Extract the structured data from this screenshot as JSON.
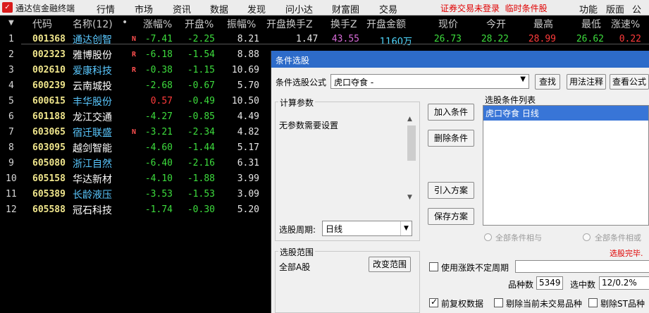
{
  "app": {
    "title": "通达信金融终端",
    "menu": [
      "行情",
      "市场",
      "资讯",
      "数据",
      "发现",
      "问小达",
      "财富圈",
      "交易"
    ],
    "status_warning": "证券交易未登录",
    "status_condition": "临时条件股",
    "right_menu": [
      "功能",
      "版面",
      "公式"
    ]
  },
  "table": {
    "headers": {
      "code": "代码",
      "name": "名称(12)",
      "dot": "•",
      "change_pct": "涨幅%",
      "open_pct": "开盘%",
      "amplitude_pct": "振幅%",
      "open_turnover": "开盘换手Z",
      "turnover": "换手Z",
      "open_amount": "开盘金额",
      "price": "现价",
      "today_open": "今开",
      "high": "最高",
      "low": "最低",
      "speed": "涨速%"
    },
    "rows": [
      {
        "idx": "1",
        "code": "001368",
        "name": "通达创智",
        "flag": "N",
        "change": "-7.41",
        "open": "-2.25",
        "amp": "8.21",
        "open_turn": "1.47",
        "turn": "43.55",
        "open_amt": "1160万",
        "price": "26.73",
        "today_open": "28.22",
        "high": "28.99",
        "low": "26.62",
        "speed": "0.22"
      },
      {
        "idx": "2",
        "code": "002323",
        "name": "雅博股份",
        "flag": "R",
        "change": "-6.18",
        "open": "-1.54",
        "amp": "8.88"
      },
      {
        "idx": "3",
        "code": "002610",
        "name": "爱康科技",
        "flag": "R",
        "change": "-0.38",
        "open": "-1.15",
        "amp": "10.69"
      },
      {
        "idx": "4",
        "code": "600239",
        "name": "云南城投",
        "flag": "",
        "change": "-2.68",
        "open": "-0.67",
        "amp": "5.70"
      },
      {
        "idx": "5",
        "code": "600615",
        "name": "丰华股份",
        "flag": "",
        "change": "0.57",
        "open": "-0.49",
        "amp": "10.50"
      },
      {
        "idx": "6",
        "code": "601188",
        "name": "龙江交通",
        "flag": "",
        "change": "-4.27",
        "open": "-0.85",
        "amp": "4.49"
      },
      {
        "idx": "7",
        "code": "603065",
        "name": "宿迁联盛",
        "flag": "N",
        "change": "-3.21",
        "open": "-2.34",
        "amp": "4.82"
      },
      {
        "idx": "8",
        "code": "603095",
        "name": "越剑智能",
        "flag": "",
        "change": "-4.60",
        "open": "-1.44",
        "amp": "5.17"
      },
      {
        "idx": "9",
        "code": "605080",
        "name": "浙江自然",
        "flag": "",
        "change": "-6.40",
        "open": "-2.16",
        "amp": "6.31"
      },
      {
        "idx": "10",
        "code": "605158",
        "name": "华达新材",
        "flag": "",
        "change": "-4.10",
        "open": "-1.88",
        "amp": "3.99"
      },
      {
        "idx": "11",
        "code": "605389",
        "name": "长龄液压",
        "flag": "",
        "change": "-3.53",
        "open": "-1.53",
        "amp": "3.09"
      },
      {
        "idx": "12",
        "code": "605588",
        "name": "冠石科技",
        "flag": "",
        "change": "-1.74",
        "open": "-0.30",
        "amp": "5.20"
      }
    ]
  },
  "dialog": {
    "title": "条件选股",
    "formula_label": "条件选股公式",
    "formula_value": "虎口夺食  -",
    "find_button": "查找",
    "usage_button": "用法注释",
    "view_button": "查看公式",
    "params_group": "计算参数",
    "params_text": "无参数需要设置",
    "period_label": "选股周期:",
    "period_value": "日线",
    "add_button": "加入条件",
    "delete_button": "删除条件",
    "import_button": "引入方案",
    "save_button": "保存方案",
    "conditions_label": "选股条件列表",
    "condition_item": "虎口夺食  日线",
    "radio_and": "全部条件相与",
    "radio_or": "全部条件相或",
    "done_text": "选股完毕.",
    "range_group": "选股范围",
    "range_value": "全部A股",
    "change_range_button": "改变范围",
    "uncertain_period": "使用涨跌不定周期",
    "stock_count_label": "品种数",
    "stock_count": "5349",
    "selected_label": "选中数",
    "selected_value": "12/0.2%",
    "fq_label": "前复权数据",
    "exclude_suspended": "剔除当前未交易品种",
    "exclude_st": "剔除ST品种"
  }
}
